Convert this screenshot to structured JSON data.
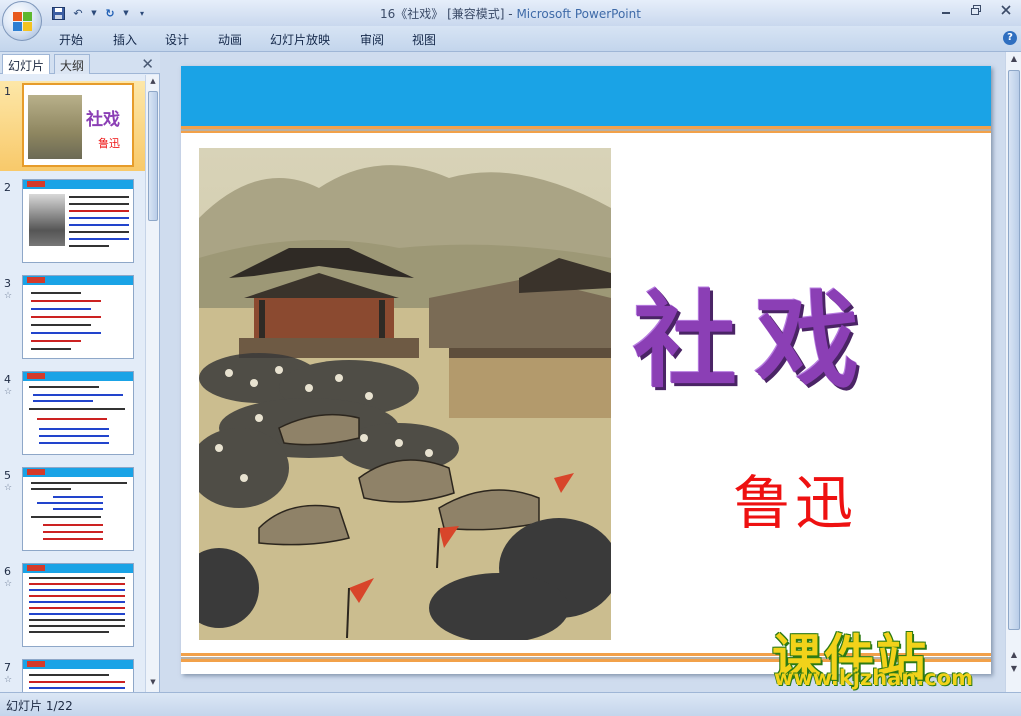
{
  "window": {
    "title": "16《社戏》 [兼容模式] - ",
    "app_name": "Microsoft PowerPoint",
    "controls": [
      "minimize-icon",
      "restore-icon",
      "close-icon"
    ]
  },
  "quick_access": {
    "icons": [
      "save-icon",
      "undo-icon",
      "redo-icon",
      "customize-icon"
    ]
  },
  "ribbon": {
    "tabs": [
      "开始",
      "插入",
      "设计",
      "动画",
      "幻灯片放映",
      "审阅",
      "视图"
    ]
  },
  "panel": {
    "tab_slides": "幻灯片",
    "tab_outline": "大纲",
    "close": "✕",
    "thumbnails": [
      {
        "number": "1",
        "selected": true
      },
      {
        "number": "2"
      },
      {
        "number": "3"
      },
      {
        "number": "4"
      },
      {
        "number": "5"
      },
      {
        "number": "6"
      },
      {
        "number": "7"
      }
    ]
  },
  "slide": {
    "title": "社戏",
    "author": "鲁迅",
    "colors": {
      "top_bar": "#1aa3e6",
      "stripe": "#f2a14a",
      "title": "#8b3fb5",
      "author": "#ee1111"
    }
  },
  "watermark": {
    "text": "课件站",
    "url": "www.kjzhan.com"
  },
  "status": {
    "slide_indicator": "幻灯片 1/22"
  }
}
